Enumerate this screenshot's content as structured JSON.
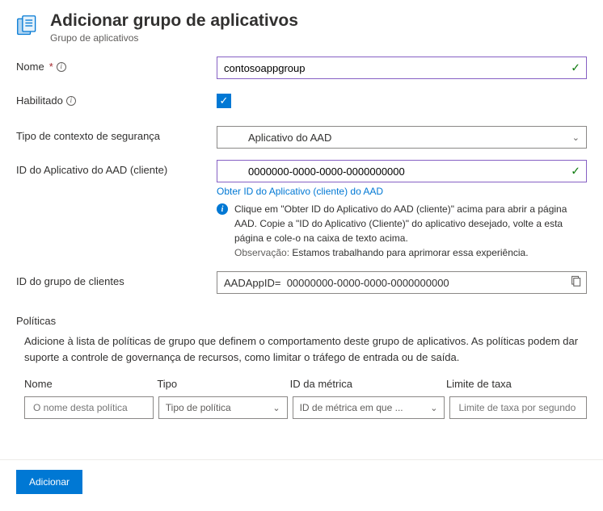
{
  "header": {
    "title": "Adicionar grupo de aplicativos",
    "subtitle": "Grupo de aplicativos"
  },
  "form": {
    "name_label": "Nome",
    "name_value": "contosoappgroup",
    "enabled_label": "Habilitado",
    "context_label": "Tipo de contexto de segurança",
    "context_value": "Aplicativo do AAD",
    "aad_app_id_label": "ID do Aplicativo do AAD (cliente)",
    "aad_app_id_value": "0000000-0000-0000-0000000000",
    "aad_link": "Obter ID do Aplicativo (cliente) do AAD",
    "info_text": "Clique em \"Obter ID do Aplicativo do AAD (cliente)\" acima para abrir a página AAD. Copie a \"ID do Aplicativo (Cliente)\" do aplicativo desejado, volte a esta página e cole-o na caixa de texto acima.",
    "obs_label": "Observação:",
    "obs_text": "Estamos trabalhando para aprimorar essa experiência.",
    "client_group_label": "ID do grupo de clientes",
    "client_group_prefix": "AADAppID=",
    "client_group_value": "00000000-0000-0000-0000000000"
  },
  "policies": {
    "section_title": "Políticas",
    "description": "Adicione à lista de políticas de grupo que definem o comportamento deste grupo de aplicativos. As políticas podem dar suporte a controle de governança de recursos, como limitar o tráfego de entrada ou de saída.",
    "col_name": "Nome",
    "col_type": "Tipo",
    "col_metric": "ID da métrica",
    "col_rate": "Limite de taxa",
    "ph_name": "O nome desta política",
    "ph_type": "Tipo de política",
    "ph_metric": "ID de métrica em que ...",
    "ph_rate": "Limite de taxa por segundo"
  },
  "footer": {
    "submit": "Adicionar"
  }
}
